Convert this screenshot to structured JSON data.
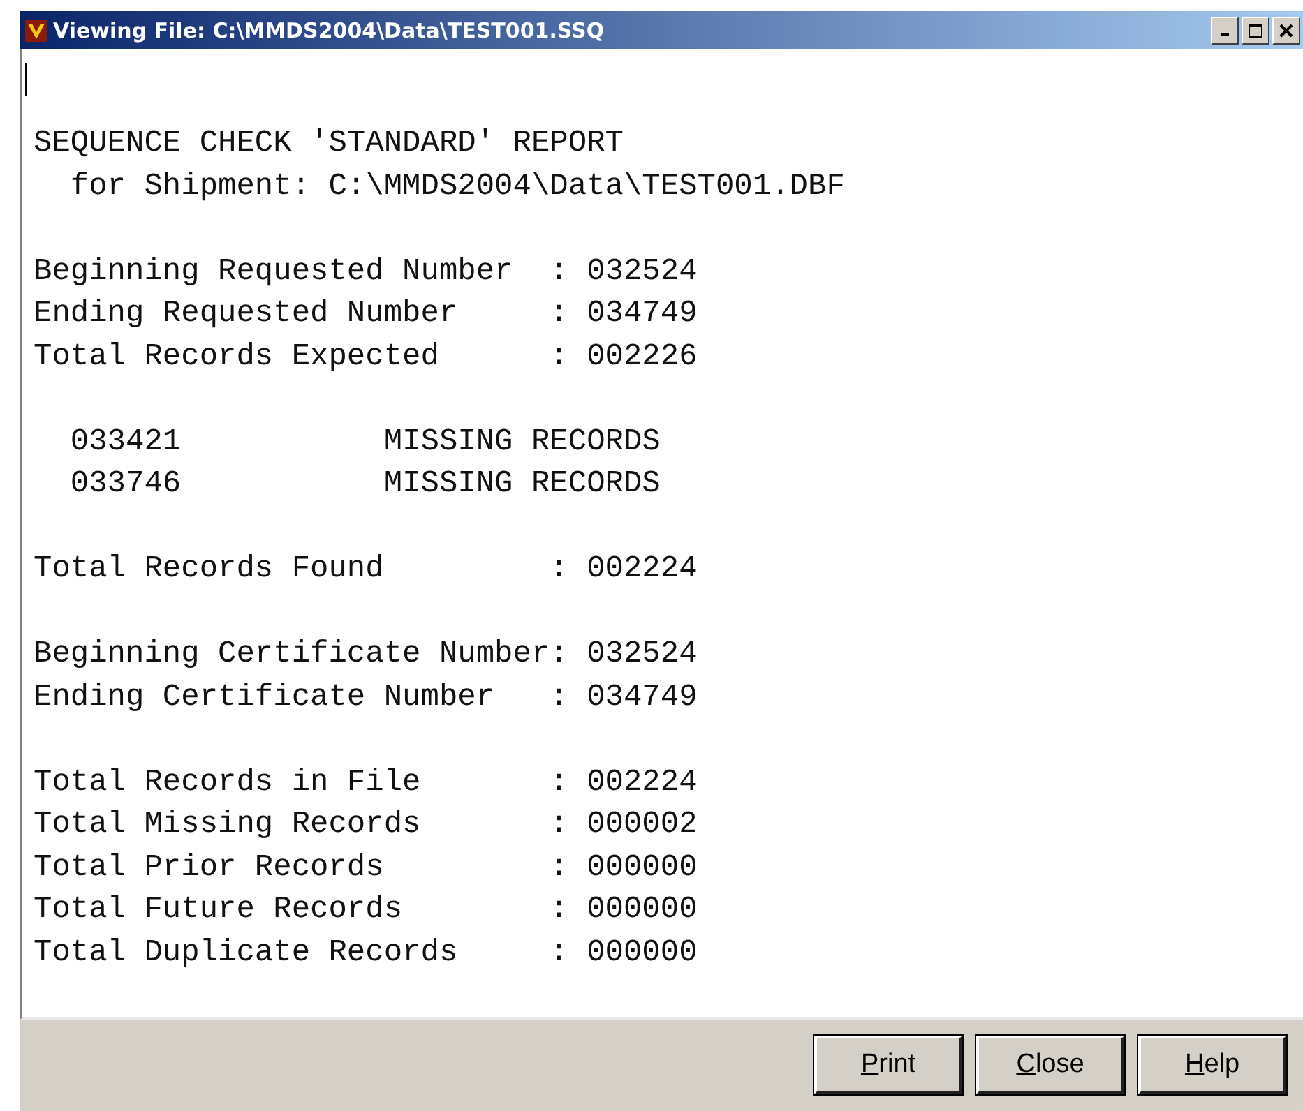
{
  "window": {
    "title": "Viewing File: C:\\MMDS2004\\Data\\TEST001.SSQ"
  },
  "report": {
    "paragraphs": [
      [
        "SEQUENCE CHECK 'STANDARD' REPORT",
        "  for Shipment: C:\\MMDS2004\\Data\\TEST001.DBF"
      ],
      [
        "Beginning Requested Number  : 032524",
        "Ending Requested Number     : 034749",
        "Total Records Expected      : 002226"
      ],
      [
        "  033421           MISSING RECORDS",
        "  033746           MISSING RECORDS"
      ],
      [
        "Total Records Found         : 002224"
      ],
      [
        "Beginning Certificate Number: 032524",
        "Ending Certificate Number   : 034749"
      ],
      [
        "Total Records in File       : 002224",
        "Total Missing Records       : 000002",
        "Total Prior Records         : 000000",
        "Total Future Records        : 000000",
        "Total Duplicate Records     : 000000"
      ]
    ]
  },
  "buttons": [
    {
      "label": "Print",
      "access_key_underlined": true
    },
    {
      "label": "Close",
      "access_key_underlined": true
    },
    {
      "label": "Help",
      "access_key_underlined": true
    }
  ]
}
